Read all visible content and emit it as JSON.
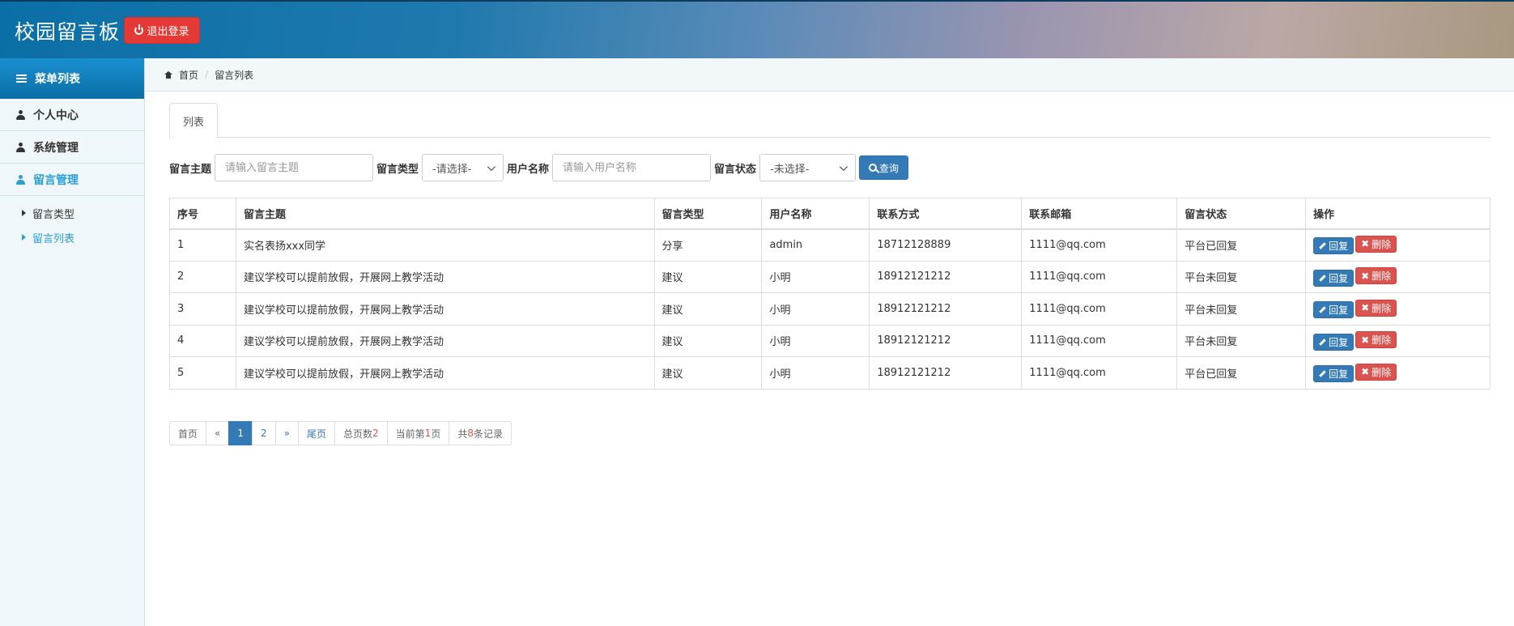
{
  "header": {
    "title": "校园留言板",
    "logout_label": "退出登录"
  },
  "sidebar": {
    "head_label": "菜单列表",
    "items": [
      {
        "label": "个人中心"
      },
      {
        "label": "系统管理"
      },
      {
        "label": "留言管理"
      }
    ],
    "sub_items": [
      {
        "label": "留言类型"
      },
      {
        "label": "留言列表"
      }
    ]
  },
  "breadcrumb": {
    "home": "首页",
    "current": "留言列表"
  },
  "tabs": {
    "list": "列表"
  },
  "filters": {
    "topic_label": "留言主题",
    "topic_placeholder": "请输入留言主题",
    "type_label": "留言类型",
    "type_selected": "-请选择-",
    "user_label": "用户名称",
    "user_placeholder": "请输入用户名称",
    "status_label": "留言状态",
    "status_selected": "-未选择-",
    "query_label": "查询"
  },
  "table": {
    "headers": [
      "序号",
      "留言主题",
      "留言类型",
      "用户名称",
      "联系方式",
      "联系邮箱",
      "留言状态",
      "操作"
    ],
    "reply_label": "回复",
    "delete_label": "删除",
    "rows": [
      {
        "no": "1",
        "topic": "实名表扬xxx同学",
        "type": "分享",
        "user": "admin",
        "phone": "18712128889",
        "email": "1111@qq.com",
        "status": "平台已回复"
      },
      {
        "no": "2",
        "topic": "建议学校可以提前放假，开展网上教学活动",
        "type": "建议",
        "user": "小明",
        "phone": "18912121212",
        "email": "1111@qq.com",
        "status": "平台未回复"
      },
      {
        "no": "3",
        "topic": "建议学校可以提前放假，开展网上教学活动",
        "type": "建议",
        "user": "小明",
        "phone": "18912121212",
        "email": "1111@qq.com",
        "status": "平台未回复"
      },
      {
        "no": "4",
        "topic": "建议学校可以提前放假，开展网上教学活动",
        "type": "建议",
        "user": "小明",
        "phone": "18912121212",
        "email": "1111@qq.com",
        "status": "平台未回复"
      },
      {
        "no": "5",
        "topic": "建议学校可以提前放假，开展网上教学活动",
        "type": "建议",
        "user": "小明",
        "phone": "18912121212",
        "email": "1111@qq.com",
        "status": "平台已回复"
      }
    ]
  },
  "pagination": {
    "first": "首页",
    "prev": "«",
    "page1": "1",
    "page2": "2",
    "next": "»",
    "last": "尾页",
    "total_pages_label": "总页数",
    "total_pages": "2",
    "current_prefix": "当前第",
    "current_page": "1",
    "current_suffix": "页",
    "records_prefix": "共",
    "records_count": "8",
    "records_suffix": "条记录"
  },
  "colors": {
    "primary": "#337ab7",
    "danger": "#d9534f",
    "logout": "#e53935",
    "sidebar_active": "#2a9fd6"
  }
}
